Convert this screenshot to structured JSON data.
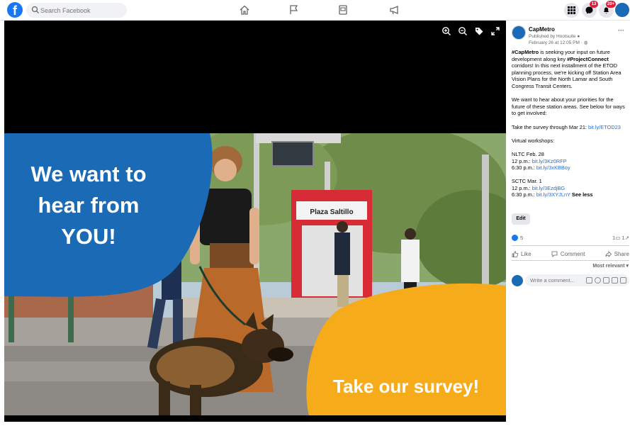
{
  "topbar": {
    "search_placeholder": "Search Facebook",
    "notifications": {
      "messenger_count": "13",
      "alerts_count": "20+"
    }
  },
  "post": {
    "page_name": "CapMetro",
    "published_by": "Published by Hootsuite",
    "date": "February 26 at 12:05 PM",
    "paragraphs": {
      "p1_hashtag": "#CapMetro",
      "p1_a": " is seeking your input on future development along key ",
      "p1_hashtag2": "#ProjectConnect",
      "p1_b": " corridors! In this next installment of the ETOD planning process, we're kicking off Station Area Vision Plans for the North Lamar and South Congress Transit Centers.",
      "p2": "We want to hear about your priorities for the future of these station areas. See below for ways to get involved:",
      "p3_text": "Take the survey through Mar 21: ",
      "p3_link": "bit.ly/ETOD23",
      "p4": "Virtual workshops:",
      "nltc_title": "NLTC Feb. 28",
      "nltc_1_time": "12 p.m.: ",
      "nltc_1_link": "bit.ly/3Kz0RFP",
      "nltc_2_time": "6:30 p.m.: ",
      "nltc_2_link": "bit.ly/3xKBBoy",
      "sctc_title": "SCTC Mar. 1",
      "sctc_1_time": "12 p.m.: ",
      "sctc_1_link": "bit.ly/3EzdjBG",
      "sctc_2_time": "6:30 p.m.: ",
      "sctc_2_link": "bit.ly/3XYJLnY",
      "see_less": "See less"
    },
    "edit_label": "Edit",
    "reaction_count": "5",
    "comments_count": "1",
    "shares_count": "1",
    "like_label": "Like",
    "comment_label": "Comment",
    "share_label": "Share",
    "most_relevant": "Most relevant",
    "comment_placeholder": "Write a comment..."
  },
  "graphic": {
    "headline_line1": "We want to",
    "headline_line2": "hear from",
    "headline_line3": "YOU!",
    "cta": "Take our survey!",
    "station_sign": "Plaza Saltillo",
    "colors": {
      "blue_panel": "#1b6ab6",
      "yellow_panel": "#f6ab1a",
      "brand": "#1877f2"
    }
  }
}
